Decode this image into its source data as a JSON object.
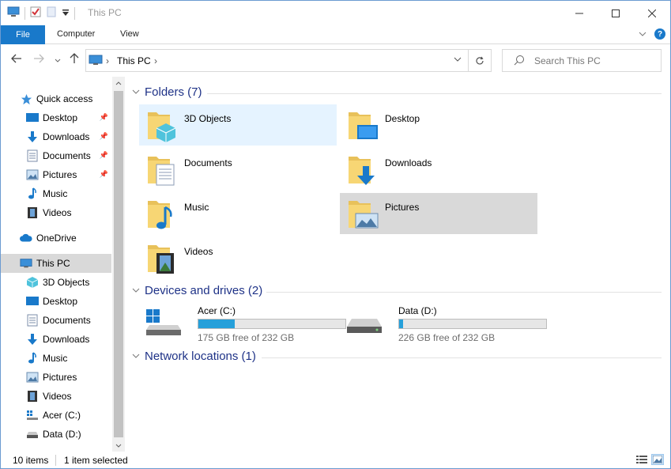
{
  "window": {
    "title": "This PC"
  },
  "ribbon": {
    "tabs": [
      "File",
      "Computer",
      "View"
    ]
  },
  "address": {
    "crumb": "This PC"
  },
  "search": {
    "placeholder": "Search This PC"
  },
  "nav": {
    "items": [
      {
        "label": "Quick access",
        "icon": "star-icon",
        "pinned": false
      },
      {
        "label": "Desktop",
        "icon": "desktop-icon",
        "pinned": true
      },
      {
        "label": "Downloads",
        "icon": "downloads-icon",
        "pinned": true
      },
      {
        "label": "Documents",
        "icon": "documents-icon",
        "pinned": true
      },
      {
        "label": "Pictures",
        "icon": "pictures-icon",
        "pinned": true
      },
      {
        "label": "Music",
        "icon": "music-icon",
        "pinned": false
      },
      {
        "label": "Videos",
        "icon": "videos-icon",
        "pinned": false
      },
      {
        "label": "OneDrive",
        "icon": "cloud-icon",
        "pinned": false
      },
      {
        "label": "This PC",
        "icon": "computer-icon",
        "pinned": false
      },
      {
        "label": "3D Objects",
        "icon": "3d-objects-icon",
        "pinned": false
      },
      {
        "label": "Desktop",
        "icon": "desktop-icon",
        "pinned": false
      },
      {
        "label": "Documents",
        "icon": "documents-icon",
        "pinned": false
      },
      {
        "label": "Downloads",
        "icon": "downloads-icon",
        "pinned": false
      },
      {
        "label": "Music",
        "icon": "music-icon",
        "pinned": false
      },
      {
        "label": "Pictures",
        "icon": "pictures-icon",
        "pinned": false
      },
      {
        "label": "Videos",
        "icon": "videos-icon",
        "pinned": false
      },
      {
        "label": "Acer (C:)",
        "icon": "windows-drive-icon",
        "pinned": false
      },
      {
        "label": "Data (D:)",
        "icon": "drive-icon",
        "pinned": false
      }
    ]
  },
  "groups": {
    "folders": {
      "title": "Folders (7)"
    },
    "devices": {
      "title": "Devices and drives (2)"
    },
    "network": {
      "title": "Network locations (1)"
    }
  },
  "folders": [
    {
      "label": "3D Objects",
      "icon": "3d-objects-folder-icon",
      "state": "hover"
    },
    {
      "label": "Desktop",
      "icon": "desktop-folder-icon",
      "state": "normal"
    },
    {
      "label": "Documents",
      "icon": "documents-folder-icon",
      "state": "normal"
    },
    {
      "label": "Downloads",
      "icon": "downloads-folder-icon",
      "state": "normal"
    },
    {
      "label": "Music",
      "icon": "music-folder-icon",
      "state": "normal"
    },
    {
      "label": "Pictures",
      "icon": "pictures-folder-icon",
      "state": "selected"
    },
    {
      "label": "Videos",
      "icon": "videos-folder-icon",
      "state": "normal"
    }
  ],
  "drives": [
    {
      "label": "Acer (C:)",
      "free_text": "175 GB free of 232 GB",
      "used_fraction": 0.246,
      "icon": "windows-drive-icon"
    },
    {
      "label": "Data (D:)",
      "free_text": "226 GB free of 232 GB",
      "used_fraction": 0.026,
      "icon": "drive-icon"
    }
  ],
  "status": {
    "item_count": "10 items",
    "selection": "1 item selected"
  },
  "colors": {
    "accent": "#1979ca",
    "header": "#1e3287",
    "drive_bar": "#26a0da",
    "selected": "#d9d9d9",
    "hover": "#e5f3ff"
  }
}
